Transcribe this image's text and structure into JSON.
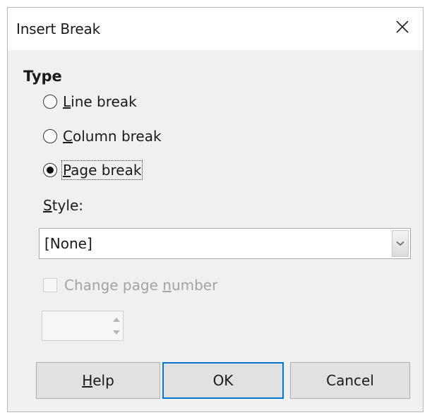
{
  "dialog": {
    "title": "Insert Break",
    "close_icon": "close-icon",
    "type_group": {
      "label": "Type",
      "options": [
        {
          "prefix": "",
          "mnemonic": "L",
          "rest": "ine break",
          "selected": false
        },
        {
          "prefix": "",
          "mnemonic": "C",
          "rest": "olumn break",
          "selected": false
        },
        {
          "prefix": "",
          "mnemonic": "P",
          "rest": "age break",
          "selected": true
        }
      ]
    },
    "style": {
      "label_mnemonic": "S",
      "label_rest": "tyle:",
      "value": "[None]"
    },
    "change_page_number": {
      "label_prefix": "Change page ",
      "label_mnemonic": "n",
      "label_rest": "umber",
      "checked": false,
      "enabled": false
    },
    "page_number_spin": {
      "value": "",
      "enabled": false
    },
    "buttons": {
      "help": {
        "mnemonic": "H",
        "rest": "elp"
      },
      "ok": "OK",
      "cancel": "Cancel"
    }
  }
}
